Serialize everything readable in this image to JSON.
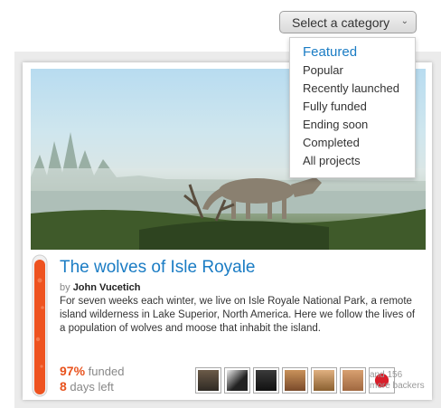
{
  "category_select": {
    "label": "Select a category",
    "options": [
      "Featured",
      "Popular",
      "Recently launched",
      "Fully funded",
      "Ending soon",
      "Completed",
      "All projects"
    ],
    "highlighted": "Featured"
  },
  "project": {
    "title": "The wolves of Isle Royale",
    "by_prefix": "by",
    "creator": "John Vucetich",
    "description": "For seven weeks each winter, we live on Isle Royale National Park, a remote island wilderness in Lake Superior, North America. Here we follow the lives of a population of wolves and moose that inhabit the island.",
    "funded_pct": "97%",
    "funded_label": "funded",
    "days_left": "8",
    "days_left_label": "days left",
    "funded_fraction": 0.97
  },
  "backers": {
    "avatars": [
      "backer-avatar-1",
      "backer-avatar-2",
      "backer-avatar-3",
      "backer-avatar-4",
      "backer-avatar-5",
      "backer-avatar-6",
      "backer-avatar-7"
    ],
    "more_line1": "and 156",
    "more_line2": "more backers"
  },
  "colors": {
    "link_blue": "#1a7cc4",
    "accent_orange": "#e8531e"
  }
}
